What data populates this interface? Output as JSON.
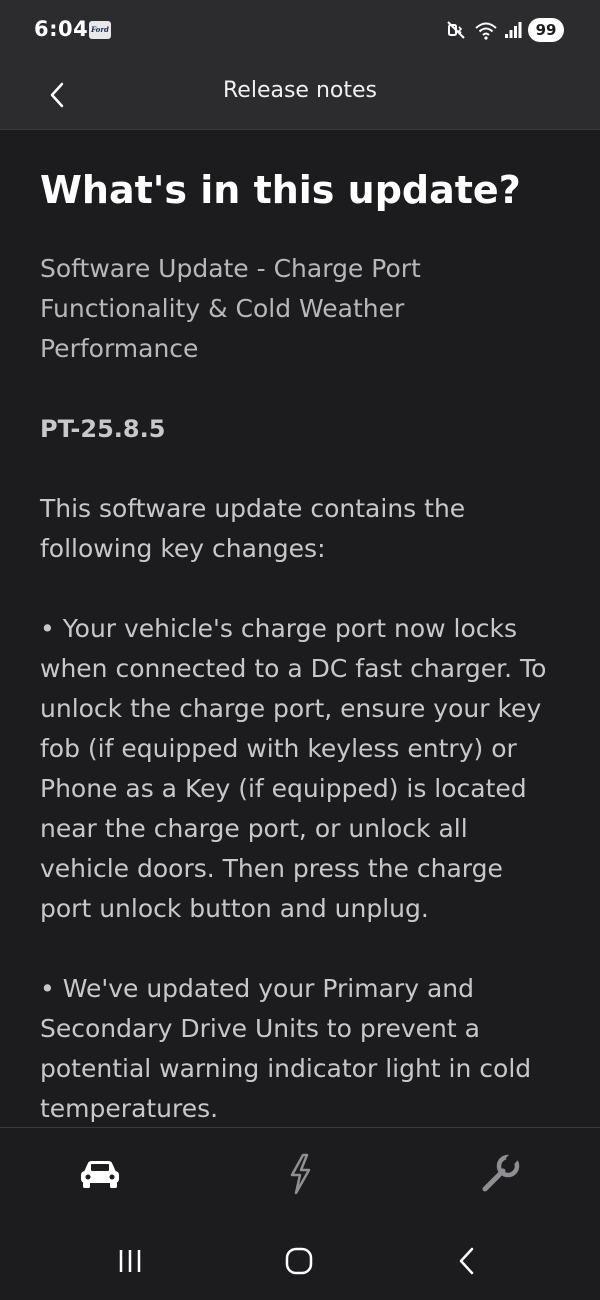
{
  "status_bar": {
    "time": "6:04",
    "app_badge": "Ford",
    "icons": [
      "mute-vibrate-icon",
      "wifi-icon",
      "signal-icon"
    ],
    "battery": "99"
  },
  "header": {
    "back_icon": "chevron-left-icon",
    "title": "Release notes"
  },
  "main": {
    "title": "What's in this update?",
    "subtitle": "Software Update - Charge Port Functionality & Cold Weather Performance",
    "version": "PT-25.8.5",
    "intro": "This software update contains the following key changes:",
    "bullets": [
      "• Your vehicle's charge port now locks when connected to a DC fast charger. To unlock the charge port, ensure your key fob (if equipped with keyless entry) or Phone as a Key (if equipped) is located near the charge port, or unlock all vehicle doors. Then press the charge port unlock button and unplug.",
      "• We've updated your Primary and Secondary Drive Units to prevent a potential warning indicator light in cold temperatures."
    ]
  },
  "bottom_nav": {
    "items": [
      "car-icon",
      "charging-bolt-icon",
      "wrench-icon"
    ]
  },
  "system_nav": {
    "items": [
      "recents-icon",
      "home-icon",
      "back-icon"
    ]
  },
  "colors": {
    "background": "#1c1c1e",
    "header_background": "#2c2c2e",
    "text_primary": "#ffffff",
    "text_secondary": "#c8c8c8"
  }
}
